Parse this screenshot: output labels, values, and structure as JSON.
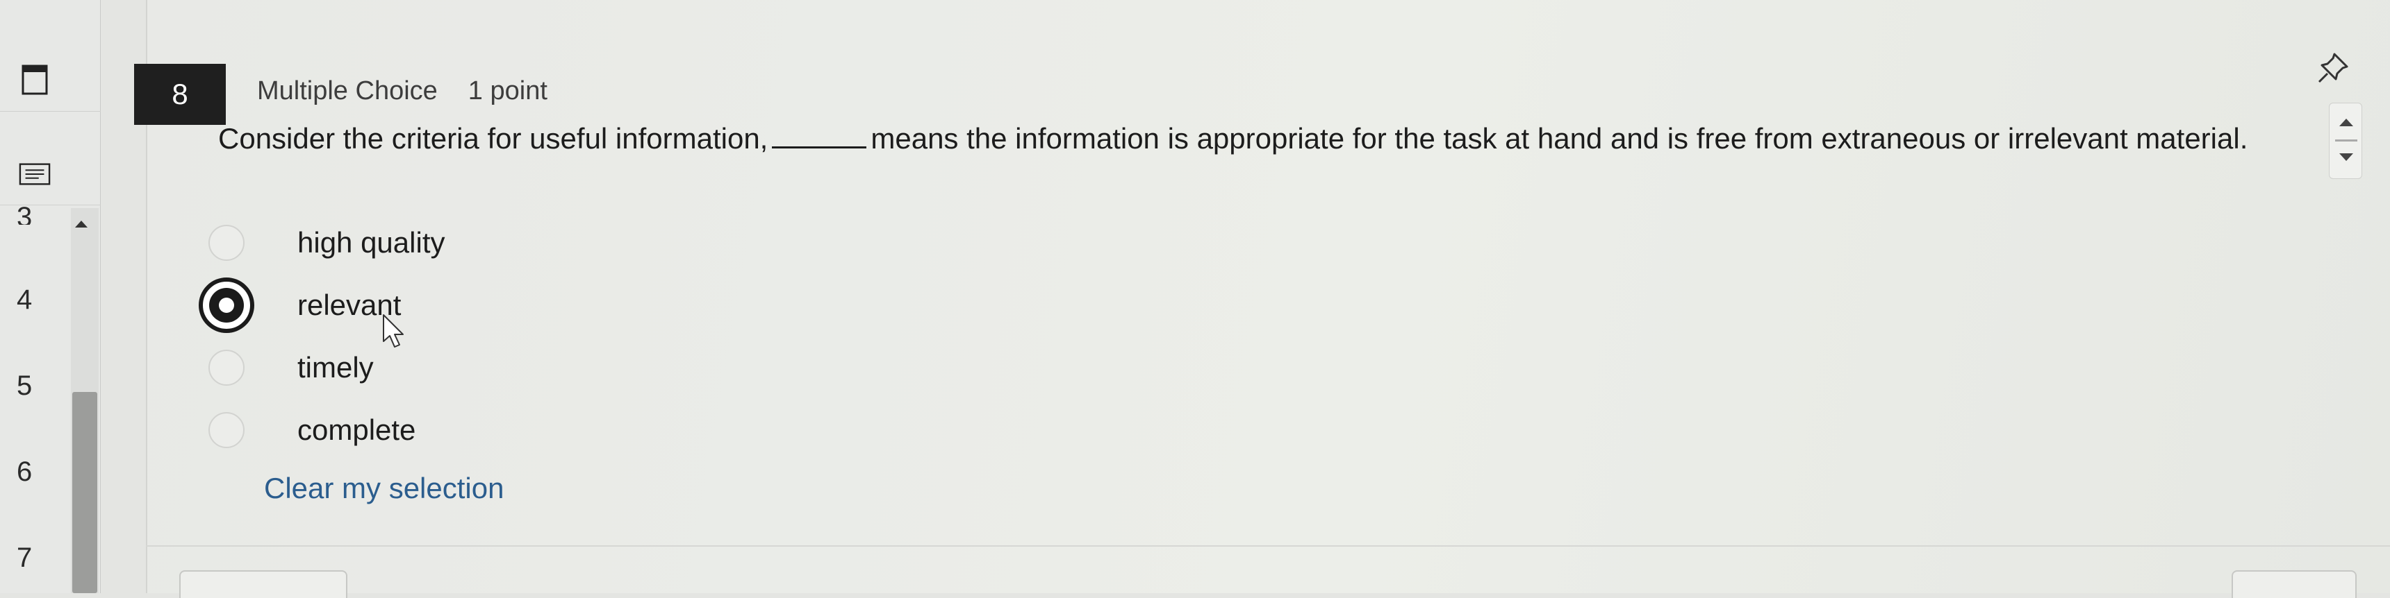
{
  "rail": {
    "question_numbers": [
      "4",
      "5",
      "6",
      "7"
    ],
    "partial_number": "3"
  },
  "question": {
    "number": "8",
    "type": "Multiple Choice",
    "points": "1 point",
    "text_before": "Consider the criteria for useful information,",
    "text_after": "means the information is appropriate for the task at hand and is free from extraneous or irrelevant material."
  },
  "options": [
    {
      "label": "high quality",
      "selected": false
    },
    {
      "label": "relevant",
      "selected": true
    },
    {
      "label": "timely",
      "selected": false
    },
    {
      "label": "complete",
      "selected": false
    }
  ],
  "clear_label": "Clear my selection",
  "colors": {
    "link": "#2b5d8e",
    "badge_bg": "#1f1f1f",
    "text": "#1c1c1c"
  },
  "icons": {
    "rail_tool_1": "panel-icon",
    "rail_tool_2": "notes-icon",
    "pin": "pin-icon",
    "cursor": "pointer-cursor-icon"
  }
}
